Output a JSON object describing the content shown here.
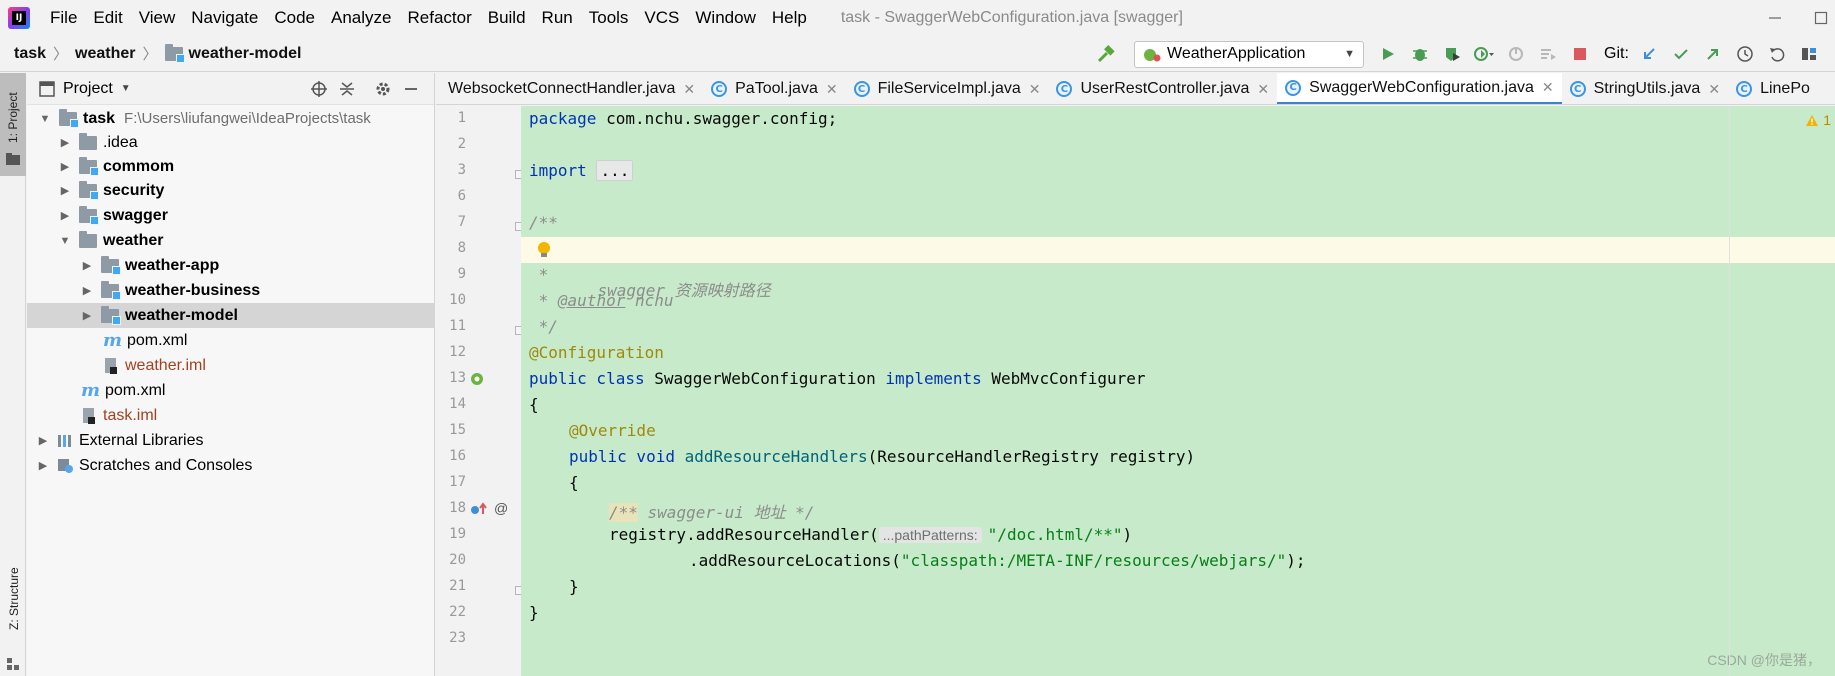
{
  "menubar": {
    "logo_text": "IJ",
    "items": [
      "File",
      "Edit",
      "View",
      "Navigate",
      "Code",
      "Analyze",
      "Refactor",
      "Build",
      "Run",
      "Tools",
      "VCS",
      "Window",
      "Help"
    ],
    "window_title": "task - SwaggerWebConfiguration.java [swagger]"
  },
  "breadcrumb": [
    "task",
    "weather",
    "weather-model"
  ],
  "toolbar": {
    "run_config": "WeatherApplication",
    "git_label": "Git:"
  },
  "tool_strip": {
    "project_label": "1: Project",
    "structure_label": "Z: Structure"
  },
  "project_panel": {
    "title": "Project",
    "tree": [
      {
        "label": "task",
        "hint": "F:\\Users\\liufangwei\\IdeaProjects\\task",
        "kind": "module",
        "bold": true,
        "expanded": true,
        "depth": 0
      },
      {
        "label": ".idea",
        "kind": "folder",
        "bold": false,
        "expanded": false,
        "depth": 1
      },
      {
        "label": "commom",
        "kind": "module",
        "bold": true,
        "expanded": false,
        "depth": 1
      },
      {
        "label": "security",
        "kind": "module",
        "bold": true,
        "expanded": false,
        "depth": 1
      },
      {
        "label": "swagger",
        "kind": "module",
        "bold": true,
        "expanded": false,
        "depth": 1
      },
      {
        "label": "weather",
        "kind": "folder",
        "bold": true,
        "expanded": true,
        "depth": 1
      },
      {
        "label": "weather-app",
        "kind": "module",
        "bold": true,
        "expanded": false,
        "depth": 2
      },
      {
        "label": "weather-business",
        "kind": "module",
        "bold": true,
        "expanded": false,
        "depth": 2
      },
      {
        "label": "weather-model",
        "kind": "module",
        "bold": true,
        "expanded": false,
        "depth": 2,
        "selected": true
      },
      {
        "label": "pom.xml",
        "kind": "maven",
        "depth": 2
      },
      {
        "label": "weather.iml",
        "kind": "iml",
        "depth": 2
      },
      {
        "label": "pom.xml",
        "kind": "maven",
        "depth": 1
      },
      {
        "label": "task.iml",
        "kind": "iml",
        "depth": 1
      },
      {
        "label": "External Libraries",
        "kind": "libs",
        "expanded": false,
        "depth": 0
      },
      {
        "label": "Scratches and Consoles",
        "kind": "scratch",
        "expanded": false,
        "depth": 0
      }
    ]
  },
  "tabs": [
    {
      "label": "WebsocketConnectHandler.java",
      "active": false,
      "icon": "C"
    },
    {
      "label": "PaTool.java",
      "active": false,
      "icon": "C"
    },
    {
      "label": "FileServiceImpl.java",
      "active": false,
      "icon": "C"
    },
    {
      "label": "UserRestController.java",
      "active": false,
      "icon": "C"
    },
    {
      "label": "SwaggerWebConfiguration.java",
      "active": true,
      "icon": "C"
    },
    {
      "label": "StringUtils.java",
      "active": false,
      "icon": "C"
    },
    {
      "label": "LinePo",
      "active": false,
      "icon": "C"
    }
  ],
  "editor": {
    "line_numbers": [
      "1",
      "2",
      "3",
      "6",
      "7",
      "8",
      "9",
      "10",
      "11",
      "12",
      "13",
      "14",
      "15",
      "16",
      "17",
      "18",
      "19",
      "20",
      "21",
      "22",
      "23"
    ],
    "warning_count": "1",
    "watermark": "CSDN @你是猪，",
    "code": {
      "l1_kw": "package",
      "l1_rest": " com.nchu.swagger.config;",
      "l3_kw": "import",
      "l3_fold": "...",
      "l7": "/**",
      "l8": "swagger 资源映射路径",
      "l9": " *",
      "l10_a": " * ",
      "l10_tag": "@author",
      "l10_b": " nchu",
      "l11": " */",
      "l12": "@Configuration",
      "l13_kw1": "public class",
      "l13_name": " SwaggerWebConfiguration ",
      "l13_kw2": "implements",
      "l13_iface": " WebMvcConfigurer",
      "l14": "{",
      "l15": "@Override",
      "l16_kw": "public void",
      "l16_mth": "addResourceHandlers",
      "l16_rest": "(ResourceHandlerRegistry registry)",
      "l17": "{",
      "l18_open": "/**",
      "l18_text": " swagger-ui 地址 */",
      "l19_a": "registry.addResourceHandler(",
      "l19_hint": "...pathPatterns:",
      "l19_str": "\"/doc.html/**\"",
      "l19_b": ")",
      "l20_a": ".addResourceLocations(",
      "l20_str": "\"classpath:/META-INF/resources/webjars/\"",
      "l20_b": ");",
      "l21": "}",
      "l22": "}"
    }
  },
  "colors": {
    "editor_bg": "#c7ebca",
    "keyword": "#0033b3",
    "annotation": "#9e880d",
    "string": "#067d17",
    "comment": "#8c8c8c",
    "accent": "#4083c9"
  }
}
